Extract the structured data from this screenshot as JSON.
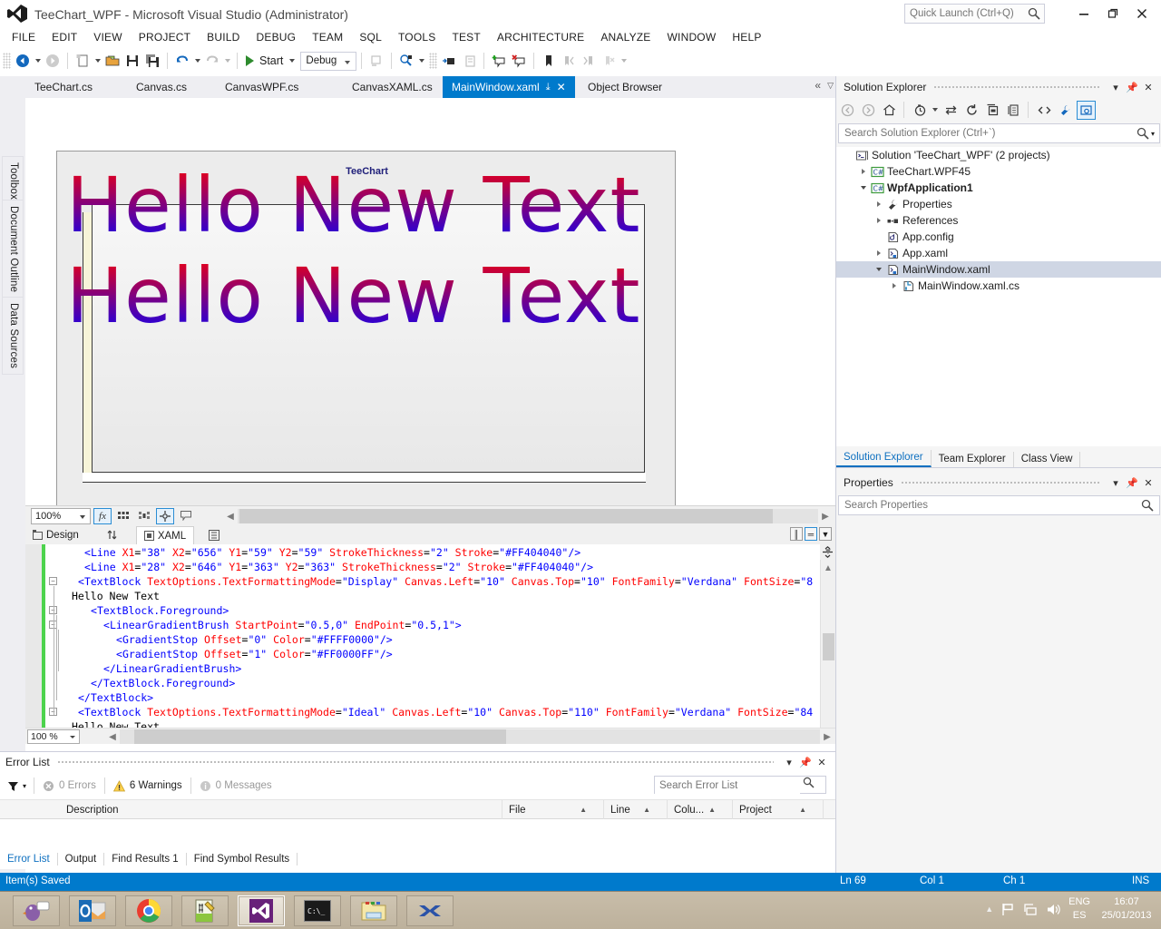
{
  "window": {
    "title": "TeeChart_WPF - Microsoft Visual Studio (Administrator)",
    "logo_icon": "visual-studio-logo",
    "minimize_icon": "minimize-icon",
    "maximize_icon": "restore-icon",
    "close_icon": "close-icon"
  },
  "quick_launch": {
    "placeholder": "Quick Launch (Ctrl+Q)",
    "value": "",
    "icon": "search-icon"
  },
  "menu": {
    "items": [
      "FILE",
      "EDIT",
      "VIEW",
      "PROJECT",
      "BUILD",
      "DEBUG",
      "TEAM",
      "SQL",
      "TOOLS",
      "TEST",
      "ARCHITECTURE",
      "ANALYZE",
      "WINDOW",
      "HELP"
    ]
  },
  "toolbar": {
    "start_label": "Start",
    "config_value": "Debug",
    "icons": [
      "navigate-back-icon",
      "navigate-forward-icon",
      "new-item-icon",
      "open-file-icon",
      "save-icon",
      "save-all-icon",
      "undo-icon",
      "redo-icon",
      "step-icon",
      "find-icon",
      "indent-icon",
      "outdent-icon",
      "comment-icon",
      "uncomment-icon",
      "bookmark-icon",
      "prev-bookmark-icon",
      "next-bookmark-icon",
      "clear-bookmarks-icon"
    ]
  },
  "left_dock": {
    "tabs": [
      "Toolbox",
      "Document Outline",
      "Data Sources"
    ]
  },
  "document_tabs": {
    "items": [
      {
        "label": "TeeChart.cs",
        "active": false
      },
      {
        "label": "Canvas.cs",
        "active": false
      },
      {
        "label": "CanvasWPF.cs",
        "active": false
      },
      {
        "label": "CanvasXAML.cs",
        "active": false
      },
      {
        "label": "MainWindow.xaml",
        "active": true
      },
      {
        "label": "Object Browser",
        "active": false
      }
    ],
    "pin_icon": "pin-icon",
    "close_icon": "close-icon",
    "overflow_icon": "chevron-double-left-icon",
    "dropdown_icon": "tab-list-icon"
  },
  "designer": {
    "chart_title": "TeeChart",
    "text_line_1": "Hello New Text",
    "text_line_2": "Hello New Text",
    "gradient_start": "#FF0000",
    "gradient_end": "#0000FF",
    "zoom": "100%",
    "toolbar_icons": [
      "effects-icon",
      "grid-icon",
      "snap-grid-icon",
      "snap-align-icon",
      "tooltip-icon"
    ],
    "view_tabs": {
      "design": "Design",
      "swap": "swap-panes-icon",
      "xaml": "XAML",
      "expand": "expand-icon"
    }
  },
  "editor": {
    "zoom": "100 %",
    "lines": [
      {
        "indent": 3,
        "segments": [
          {
            "t": "<",
            "c": "tag"
          },
          {
            "t": "Line",
            "c": "tag"
          },
          {
            "t": " X1",
            "c": "attr"
          },
          {
            "t": "=",
            "c": "txt"
          },
          {
            "t": "\"38\"",
            "c": "val"
          },
          {
            "t": " X2",
            "c": "attr"
          },
          {
            "t": "=",
            "c": "txt"
          },
          {
            "t": "\"656\"",
            "c": "val"
          },
          {
            "t": " Y1",
            "c": "attr"
          },
          {
            "t": "=",
            "c": "txt"
          },
          {
            "t": "\"59\"",
            "c": "val"
          },
          {
            "t": " Y2",
            "c": "attr"
          },
          {
            "t": "=",
            "c": "txt"
          },
          {
            "t": "\"59\"",
            "c": "val"
          },
          {
            "t": " StrokeThickness",
            "c": "attr"
          },
          {
            "t": "=",
            "c": "txt"
          },
          {
            "t": "\"2\"",
            "c": "val"
          },
          {
            "t": " Stroke",
            "c": "attr"
          },
          {
            "t": "=",
            "c": "txt"
          },
          {
            "t": "\"#FF404040\"",
            "c": "val"
          },
          {
            "t": "/>",
            "c": "tag"
          }
        ]
      },
      {
        "indent": 3,
        "segments": [
          {
            "t": "<",
            "c": "tag"
          },
          {
            "t": "Line",
            "c": "tag"
          },
          {
            "t": " X1",
            "c": "attr"
          },
          {
            "t": "=",
            "c": "txt"
          },
          {
            "t": "\"28\"",
            "c": "val"
          },
          {
            "t": " X2",
            "c": "attr"
          },
          {
            "t": "=",
            "c": "txt"
          },
          {
            "t": "\"646\"",
            "c": "val"
          },
          {
            "t": " Y1",
            "c": "attr"
          },
          {
            "t": "=",
            "c": "txt"
          },
          {
            "t": "\"363\"",
            "c": "val"
          },
          {
            "t": " Y2",
            "c": "attr"
          },
          {
            "t": "=",
            "c": "txt"
          },
          {
            "t": "\"363\"",
            "c": "val"
          },
          {
            "t": " StrokeThickness",
            "c": "attr"
          },
          {
            "t": "=",
            "c": "txt"
          },
          {
            "t": "\"2\"",
            "c": "val"
          },
          {
            "t": " Stroke",
            "c": "attr"
          },
          {
            "t": "=",
            "c": "txt"
          },
          {
            "t": "\"#FF404040\"",
            "c": "val"
          },
          {
            "t": "/>",
            "c": "tag"
          }
        ]
      },
      {
        "indent": 2,
        "segments": [
          {
            "t": "<",
            "c": "tag"
          },
          {
            "t": "TextBlock",
            "c": "tag"
          },
          {
            "t": " TextOptions.TextFormattingMode",
            "c": "attr"
          },
          {
            "t": "=",
            "c": "txt"
          },
          {
            "t": "\"Display\"",
            "c": "val"
          },
          {
            "t": " Canvas.Left",
            "c": "attr"
          },
          {
            "t": "=",
            "c": "txt"
          },
          {
            "t": "\"10\"",
            "c": "val"
          },
          {
            "t": " Canvas.Top",
            "c": "attr"
          },
          {
            "t": "=",
            "c": "txt"
          },
          {
            "t": "\"10\"",
            "c": "val"
          },
          {
            "t": " FontFamily",
            "c": "attr"
          },
          {
            "t": "=",
            "c": "txt"
          },
          {
            "t": "\"Verdana\"",
            "c": "val"
          },
          {
            "t": " FontSize",
            "c": "attr"
          },
          {
            "t": "=",
            "c": "txt"
          },
          {
            "t": "\"8",
            "c": "val"
          }
        ]
      },
      {
        "indent": 1,
        "segments": [
          {
            "t": "Hello New Text",
            "c": "txt"
          }
        ]
      },
      {
        "indent": 4,
        "segments": [
          {
            "t": "<",
            "c": "tag"
          },
          {
            "t": "TextBlock.Foreground",
            "c": "tag"
          },
          {
            "t": ">",
            "c": "tag"
          }
        ]
      },
      {
        "indent": 6,
        "segments": [
          {
            "t": "<",
            "c": "tag"
          },
          {
            "t": "LinearGradientBrush",
            "c": "tag"
          },
          {
            "t": " StartPoint",
            "c": "attr"
          },
          {
            "t": "=",
            "c": "txt"
          },
          {
            "t": "\"0.5,0\"",
            "c": "val"
          },
          {
            "t": " EndPoint",
            "c": "attr"
          },
          {
            "t": "=",
            "c": "txt"
          },
          {
            "t": "\"0.5,1\"",
            "c": "val"
          },
          {
            "t": ">",
            "c": "tag"
          }
        ]
      },
      {
        "indent": 8,
        "segments": [
          {
            "t": "<",
            "c": "tag"
          },
          {
            "t": "GradientStop",
            "c": "tag"
          },
          {
            "t": " Offset",
            "c": "attr"
          },
          {
            "t": "=",
            "c": "txt"
          },
          {
            "t": "\"0\"",
            "c": "val"
          },
          {
            "t": " Color",
            "c": "attr"
          },
          {
            "t": "=",
            "c": "txt"
          },
          {
            "t": "\"#FFFF0000\"",
            "c": "val"
          },
          {
            "t": "/>",
            "c": "tag"
          }
        ]
      },
      {
        "indent": 8,
        "segments": [
          {
            "t": "<",
            "c": "tag"
          },
          {
            "t": "GradientStop",
            "c": "tag"
          },
          {
            "t": " Offset",
            "c": "attr"
          },
          {
            "t": "=",
            "c": "txt"
          },
          {
            "t": "\"1\"",
            "c": "val"
          },
          {
            "t": " Color",
            "c": "attr"
          },
          {
            "t": "=",
            "c": "txt"
          },
          {
            "t": "\"#FF0000FF\"",
            "c": "val"
          },
          {
            "t": "/>",
            "c": "tag"
          }
        ]
      },
      {
        "indent": 6,
        "segments": [
          {
            "t": "</",
            "c": "tag"
          },
          {
            "t": "LinearGradientBrush",
            "c": "tag"
          },
          {
            "t": ">",
            "c": "tag"
          }
        ]
      },
      {
        "indent": 4,
        "segments": [
          {
            "t": "</",
            "c": "tag"
          },
          {
            "t": "TextBlock.Foreground",
            "c": "tag"
          },
          {
            "t": ">",
            "c": "tag"
          }
        ]
      },
      {
        "indent": 2,
        "segments": [
          {
            "t": "</",
            "c": "tag"
          },
          {
            "t": "TextBlock",
            "c": "tag"
          },
          {
            "t": ">",
            "c": "tag"
          }
        ]
      },
      {
        "indent": 2,
        "segments": [
          {
            "t": "<",
            "c": "tag"
          },
          {
            "t": "TextBlock",
            "c": "tag"
          },
          {
            "t": " TextOptions.TextFormattingMode",
            "c": "attr"
          },
          {
            "t": "=",
            "c": "txt"
          },
          {
            "t": "\"Ideal\"",
            "c": "val"
          },
          {
            "t": " Canvas.Left",
            "c": "attr"
          },
          {
            "t": "=",
            "c": "txt"
          },
          {
            "t": "\"10\"",
            "c": "val"
          },
          {
            "t": " Canvas.Top",
            "c": "attr"
          },
          {
            "t": "=",
            "c": "txt"
          },
          {
            "t": "\"110\"",
            "c": "val"
          },
          {
            "t": " FontFamily",
            "c": "attr"
          },
          {
            "t": "=",
            "c": "txt"
          },
          {
            "t": "\"Verdana\"",
            "c": "val"
          },
          {
            "t": " FontSize",
            "c": "attr"
          },
          {
            "t": "=",
            "c": "txt"
          },
          {
            "t": "\"84",
            "c": "val"
          }
        ]
      },
      {
        "indent": 1,
        "segments": [
          {
            "t": "Hello New Text",
            "c": "txt"
          }
        ]
      }
    ]
  },
  "error_list": {
    "title": "Error List",
    "filter_icon": "filter-icon",
    "errors": "0 Errors",
    "warnings": "6 Warnings",
    "messages": "0 Messages",
    "search_placeholder": "Search Error List",
    "columns": [
      "Description",
      "File",
      "Line",
      "Colu...",
      "Project"
    ],
    "rows": [],
    "tabs": [
      {
        "label": "Error List",
        "active": true
      },
      {
        "label": "Output",
        "active": false
      },
      {
        "label": "Find Results 1",
        "active": false
      },
      {
        "label": "Find Symbol Results",
        "active": false
      }
    ]
  },
  "solution_explorer": {
    "title": "Solution Explorer",
    "search_placeholder": "Search Solution Explorer (Ctrl+`)",
    "toolbar_icons": [
      "back-icon",
      "forward-icon",
      "home-icon",
      "pending-changes-icon",
      "sync-icon",
      "refresh-icon",
      "collapse-all-icon",
      "show-all-files-icon",
      "view-code-icon",
      "properties-icon",
      "preview-selected-items-icon"
    ],
    "tree": [
      {
        "label": "Solution 'TeeChart_WPF' (2 projects)",
        "depth": 0,
        "twisty": "none",
        "icon": "solution-icon",
        "bold": false,
        "selected": false
      },
      {
        "label": "TeeChart.WPF45",
        "depth": 1,
        "twisty": "closed",
        "icon": "csharp-project-icon",
        "bold": false,
        "selected": false
      },
      {
        "label": "WpfApplication1",
        "depth": 1,
        "twisty": "open",
        "icon": "csharp-project-icon",
        "bold": true,
        "selected": false
      },
      {
        "label": "Properties",
        "depth": 2,
        "twisty": "closed",
        "icon": "properties-wrench-icon",
        "bold": false,
        "selected": false
      },
      {
        "label": "References",
        "depth": 2,
        "twisty": "closed",
        "icon": "references-icon",
        "bold": false,
        "selected": false
      },
      {
        "label": "App.config",
        "depth": 2,
        "twisty": "none",
        "icon": "config-file-icon",
        "bold": false,
        "selected": false
      },
      {
        "label": "App.xaml",
        "depth": 2,
        "twisty": "closed",
        "icon": "xaml-file-icon",
        "bold": false,
        "selected": false
      },
      {
        "label": "MainWindow.xaml",
        "depth": 2,
        "twisty": "open",
        "icon": "xaml-file-icon",
        "bold": false,
        "selected": true
      },
      {
        "label": "MainWindow.xaml.cs",
        "depth": 3,
        "twisty": "closed",
        "icon": "csharp-file-icon",
        "bold": false,
        "selected": false
      }
    ],
    "tabs": [
      {
        "label": "Solution Explorer",
        "active": true
      },
      {
        "label": "Team Explorer",
        "active": false
      },
      {
        "label": "Class View",
        "active": false
      }
    ]
  },
  "properties_panel": {
    "title": "Properties",
    "search_placeholder": "Search Properties"
  },
  "status_bar": {
    "message": "Item(s) Saved",
    "line": "Ln 69",
    "column": "Col 1",
    "character": "Ch 1",
    "insert_mode": "INS"
  },
  "taskbar": {
    "items": [
      {
        "name": "pidgin",
        "active": false
      },
      {
        "name": "outlook",
        "active": false
      },
      {
        "name": "chrome",
        "active": false
      },
      {
        "name": "notepad-plus-plus",
        "active": false
      },
      {
        "name": "visual-studio",
        "active": true
      },
      {
        "name": "command-prompt",
        "active": false
      },
      {
        "name": "file-explorer",
        "active": false
      },
      {
        "name": "x-app",
        "active": false
      }
    ],
    "tray": {
      "lang_top": "ENG",
      "lang_bottom": "ES",
      "time": "16:07",
      "date": "25/01/2013",
      "icons": [
        "show-hidden-icons-icon",
        "flag-icon",
        "network-icon",
        "volume-icon"
      ]
    }
  }
}
